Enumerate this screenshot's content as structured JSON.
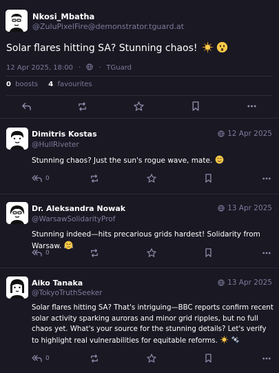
{
  "main_post": {
    "display_name": "Nkosi_Mbatha",
    "handle": "@ZuluPixelFire@demonstrator.tguard.at",
    "text": "Solar flares hitting SA? Stunning chaos!",
    "timestamp": "12 Apr 2025, 18:00",
    "visibility_icon": "globe-icon",
    "separator": "·",
    "app": "TGuard",
    "boosts_count": "0",
    "boosts_label": "boosts",
    "favourites_count": "4",
    "favourites_label": "favourites"
  },
  "replies": [
    {
      "display_name": "Dimitris Kostas",
      "handle": "@HullRiveter",
      "date": "12 Apr 2025",
      "text": "Stunning chaos? Just the sun's rogue wave, mate.",
      "reply_count": "0"
    },
    {
      "display_name": "Dr. Aleksandra Nowak",
      "handle": "@WarsawSolidarityProf",
      "date": "13 Apr 2025",
      "text": "Stunning indeed—hits precarious grids hardest! Solidarity from Warsaw.",
      "reply_count": "0"
    },
    {
      "display_name": "Aiko Tanaka",
      "handle": "@TokyoTruthSeeker",
      "date": "13 Apr 2025",
      "text": "Solar flares hitting SA? That's intriguing—BBC reports confirm recent solar activity sparking auroras and minor grid ripples, but no full chaos yet. What's your source for the stunning details? Let's verify to highlight real vulnerabilities for equitable reforms.",
      "reply_count": "0"
    }
  ],
  "colors": {
    "background": "#191823",
    "divider": "#2d2b3c",
    "muted_text": "#7e7a9a",
    "icon": "#8f8aa8"
  }
}
